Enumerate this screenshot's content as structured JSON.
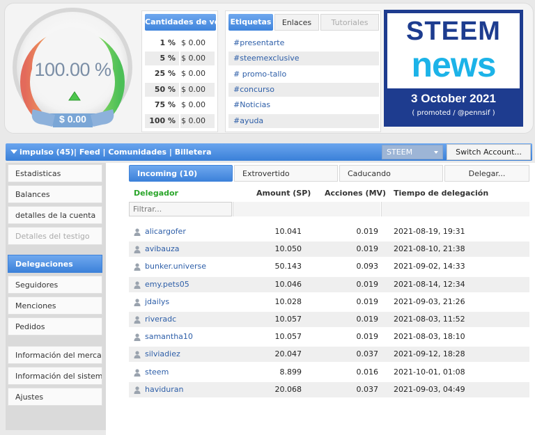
{
  "gauge": {
    "value": "100.00 %",
    "dollar": "$ 0.00"
  },
  "vote_box": {
    "tab_label": "Cantidades de voto",
    "rows": [
      {
        "pct": "1 %",
        "amount": "$ 0.00"
      },
      {
        "pct": "5 %",
        "amount": "$ 0.00"
      },
      {
        "pct": "25 %",
        "amount": "$ 0.00"
      },
      {
        "pct": "50 %",
        "amount": "$ 0.00"
      },
      {
        "pct": "75 %",
        "amount": "$ 0.00"
      },
      {
        "pct": "100 %",
        "amount": "$ 0.00"
      }
    ]
  },
  "tag_box": {
    "tabs": [
      "Etiquetas",
      "Enlaces",
      "Tutoriales"
    ],
    "tags": [
      "#presentarte",
      "#steemexclusive",
      "# promo-tallo",
      "#concurso",
      "#Noticias",
      "#ayuda"
    ]
  },
  "news": {
    "line1": "STEEM",
    "line2": "news",
    "date": "3 October 2021",
    "promo": "( promoted / @pennsif )"
  },
  "navbar": {
    "text": "impulso (45)| Feed | Comunidades | Billetera",
    "select": "STEEM",
    "switch_label": "Switch Account..."
  },
  "sidebar": {
    "items": [
      "Estadisticas",
      "Balances",
      "detalles de la cuenta",
      "Detalles del testigo",
      "Delegaciones",
      "Seguidores",
      "Menciones",
      "Pedidos",
      "Información del mercado",
      "Información del sistema",
      "Ajustes"
    ]
  },
  "main": {
    "tabs": [
      "Incoming (10)",
      "Extrovertido",
      "Caducando",
      "Delegar..."
    ],
    "headers": {
      "delegator": "Delegador",
      "amount": "Amount (SP)",
      "actions": "Acciones (MV)",
      "time": "Tiempo de delegación"
    },
    "filter_placeholder": "Filtrar...",
    "rows": [
      {
        "user": "alicargofer",
        "amount": "10.041",
        "actions": "0.019",
        "time": "2021-08-19, 19:31"
      },
      {
        "user": "avibauza",
        "amount": "10.050",
        "actions": "0.019",
        "time": "2021-08-10, 21:38"
      },
      {
        "user": "bunker.universe",
        "amount": "50.143",
        "actions": "0.093",
        "time": "2021-09-02, 14:33"
      },
      {
        "user": "emy.pets05",
        "amount": "10.046",
        "actions": "0.019",
        "time": "2021-08-14, 12:34"
      },
      {
        "user": "jdailys",
        "amount": "10.028",
        "actions": "0.019",
        "time": "2021-09-03, 21:26"
      },
      {
        "user": "riveradc",
        "amount": "10.057",
        "actions": "0.019",
        "time": "2021-08-03, 11:52"
      },
      {
        "user": "samantha10",
        "amount": "10.057",
        "actions": "0.019",
        "time": "2021-08-03, 18:10"
      },
      {
        "user": "silviadiez",
        "amount": "20.047",
        "actions": "0.037",
        "time": "2021-09-12, 18:28"
      },
      {
        "user": "steem",
        "amount": "8.899",
        "actions": "0.016",
        "time": "2021-10-01, 01:08"
      },
      {
        "user": "haviduran",
        "amount": "20.068",
        "actions": "0.037",
        "time": "2021-09-03, 04:49"
      }
    ]
  },
  "colors": {
    "accent": "#3d82da",
    "link": "#2d5ea8",
    "green_header": "#2aa52a",
    "news_bg": "#1e3c8f",
    "news_cyan": "#1cb3e8"
  }
}
